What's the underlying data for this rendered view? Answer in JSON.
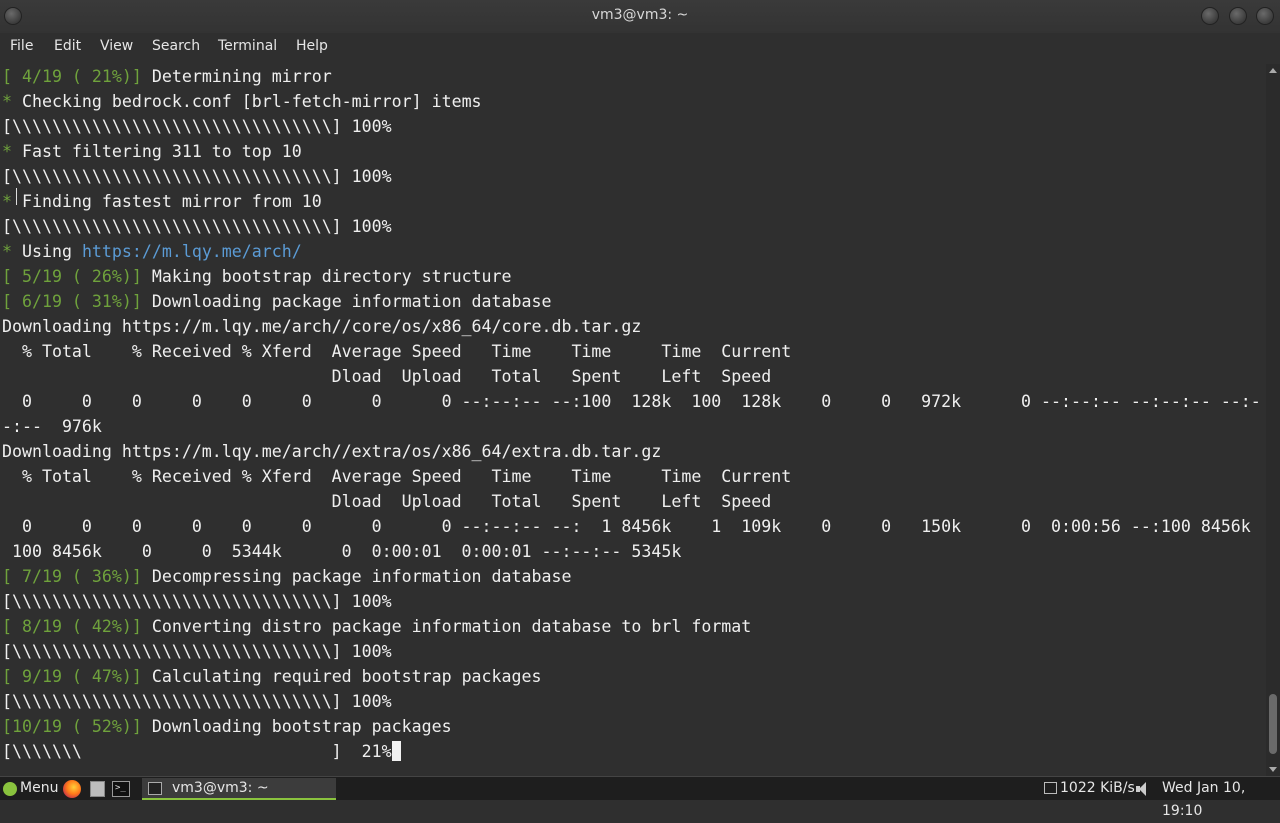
{
  "window": {
    "title": "vm3@vm3: ~"
  },
  "menubar": {
    "items": [
      "File",
      "Edit",
      "View",
      "Search",
      "Terminal",
      "Help"
    ]
  },
  "terminal": {
    "lines": [
      {
        "prefix": "[ 4/19 ( 21%)]",
        "text": " Determining mirror"
      },
      {
        "prefix": "*",
        "text": " Checking bedrock.conf [brl-fetch-mirror] items"
      },
      {
        "prefix": "",
        "text": "[\\\\\\\\\\\\\\\\\\\\\\\\\\\\\\\\\\\\\\\\\\\\\\\\\\\\\\\\\\\\\\\\] 100%"
      },
      {
        "prefix": "*",
        "text": " Fast filtering 311 to top 10"
      },
      {
        "prefix": "",
        "text": "[\\\\\\\\\\\\\\\\\\\\\\\\\\\\\\\\\\\\\\\\\\\\\\\\\\\\\\\\\\\\\\\\] 100%"
      },
      {
        "prefix": "*",
        "text": " Finding fastest mirror from 10"
      },
      {
        "prefix": "",
        "text": "[\\\\\\\\\\\\\\\\\\\\\\\\\\\\\\\\\\\\\\\\\\\\\\\\\\\\\\\\\\\\\\\\] 100%"
      },
      {
        "prefix": "*",
        "text": " Using ",
        "link": "https://m.lqy.me/arch/"
      },
      {
        "prefix": "[ 5/19 ( 26%)]",
        "text": " Making bootstrap directory structure"
      },
      {
        "prefix": "[ 6/19 ( 31%)]",
        "text": " Downloading package information database"
      },
      {
        "prefix": "",
        "text": "Downloading https://m.lqy.me/arch//core/os/x86_64/core.db.tar.gz"
      },
      {
        "prefix": "",
        "text": "  % Total    % Received % Xferd  Average Speed   Time    Time     Time  Current"
      },
      {
        "prefix": "",
        "text": "                                 Dload  Upload   Total   Spent    Left  Speed"
      },
      {
        "prefix": "",
        "text": "  0     0    0     0    0     0      0      0 --:--:-- --:100  128k  100  128k    0     0   972k      0 --:--:-- --:--:-- --:-"
      },
      {
        "prefix": "",
        "text": "-:--  976k"
      },
      {
        "prefix": "",
        "text": "Downloading https://m.lqy.me/arch//extra/os/x86_64/extra.db.tar.gz"
      },
      {
        "prefix": "",
        "text": "  % Total    % Received % Xferd  Average Speed   Time    Time     Time  Current"
      },
      {
        "prefix": "",
        "text": "                                 Dload  Upload   Total   Spent    Left  Speed"
      },
      {
        "prefix": "",
        "text": "  0     0    0     0    0     0      0      0 --:--:-- --:  1 8456k    1  109k    0     0   150k      0  0:00:56 --:100 8456k"
      },
      {
        "prefix": "",
        "text": " 100 8456k    0     0  5344k      0  0:00:01  0:00:01 --:--:-- 5345k"
      },
      {
        "prefix": "[ 7/19 ( 36%)]",
        "text": " Decompressing package information database"
      },
      {
        "prefix": "",
        "text": "[\\\\\\\\\\\\\\\\\\\\\\\\\\\\\\\\\\\\\\\\\\\\\\\\\\\\\\\\\\\\\\\\] 100%"
      },
      {
        "prefix": "[ 8/19 ( 42%)]",
        "text": " Converting distro package information database to brl format"
      },
      {
        "prefix": "",
        "text": "[\\\\\\\\\\\\\\\\\\\\\\\\\\\\\\\\\\\\\\\\\\\\\\\\\\\\\\\\\\\\\\\\] 100%"
      },
      {
        "prefix": "[ 9/19 ( 47%)]",
        "text": " Calculating required bootstrap packages"
      },
      {
        "prefix": "",
        "text": "[\\\\\\\\\\\\\\\\\\\\\\\\\\\\\\\\\\\\\\\\\\\\\\\\\\\\\\\\\\\\\\\\] 100%"
      },
      {
        "prefix": "[10/19 ( 52%)]",
        "text": " Downloading bootstrap packages"
      },
      {
        "prefix": "",
        "text": "[\\\\\\\\\\\\\\                         ]  21%",
        "cursor": true
      }
    ]
  },
  "taskbar": {
    "menu_label": "Menu",
    "window_button_label": "vm3@vm3: ~",
    "network_speed": "1022 KiB/s",
    "clock": "Wed Jan 10, 19:10"
  },
  "colors": {
    "prompt_green": "#6fa23c",
    "link_blue": "#5b9bd5",
    "background": "#2f2f2f",
    "taskbar_accent": "#8ac33e"
  }
}
